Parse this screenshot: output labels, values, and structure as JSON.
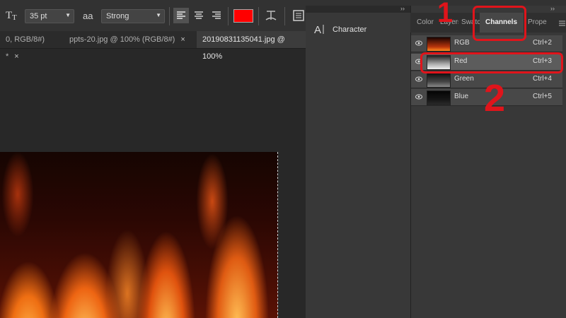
{
  "options_bar": {
    "font_size": "35 pt",
    "aa_icon": "aa",
    "aa_method": "Strong",
    "text_color": "#ff0000"
  },
  "tabs": [
    {
      "label": "0, RGB/8#) *",
      "close": "×"
    },
    {
      "label": "ppts-20.jpg @ 100% (RGB/8#)",
      "close": "×"
    },
    {
      "label": "20190831135041.jpg @ 100%",
      "close": ""
    }
  ],
  "character_panel": {
    "title": "Character"
  },
  "right_panel": {
    "collapse_glyph": "››",
    "tabs": [
      {
        "label": "Color"
      },
      {
        "label": "Layers"
      },
      {
        "label": "Swatches"
      },
      {
        "label": "Channels",
        "active": true
      },
      {
        "label": "Prope"
      }
    ],
    "channels": [
      {
        "name": "RGB",
        "shortcut": "Ctrl+2"
      },
      {
        "name": "Red",
        "shortcut": "Ctrl+3"
      },
      {
        "name": "Green",
        "shortcut": "Ctrl+4"
      },
      {
        "name": "Blue",
        "shortcut": "Ctrl+5"
      }
    ]
  },
  "annotations": {
    "step1": "1",
    "step2": "2",
    "color": "#e0141b"
  }
}
